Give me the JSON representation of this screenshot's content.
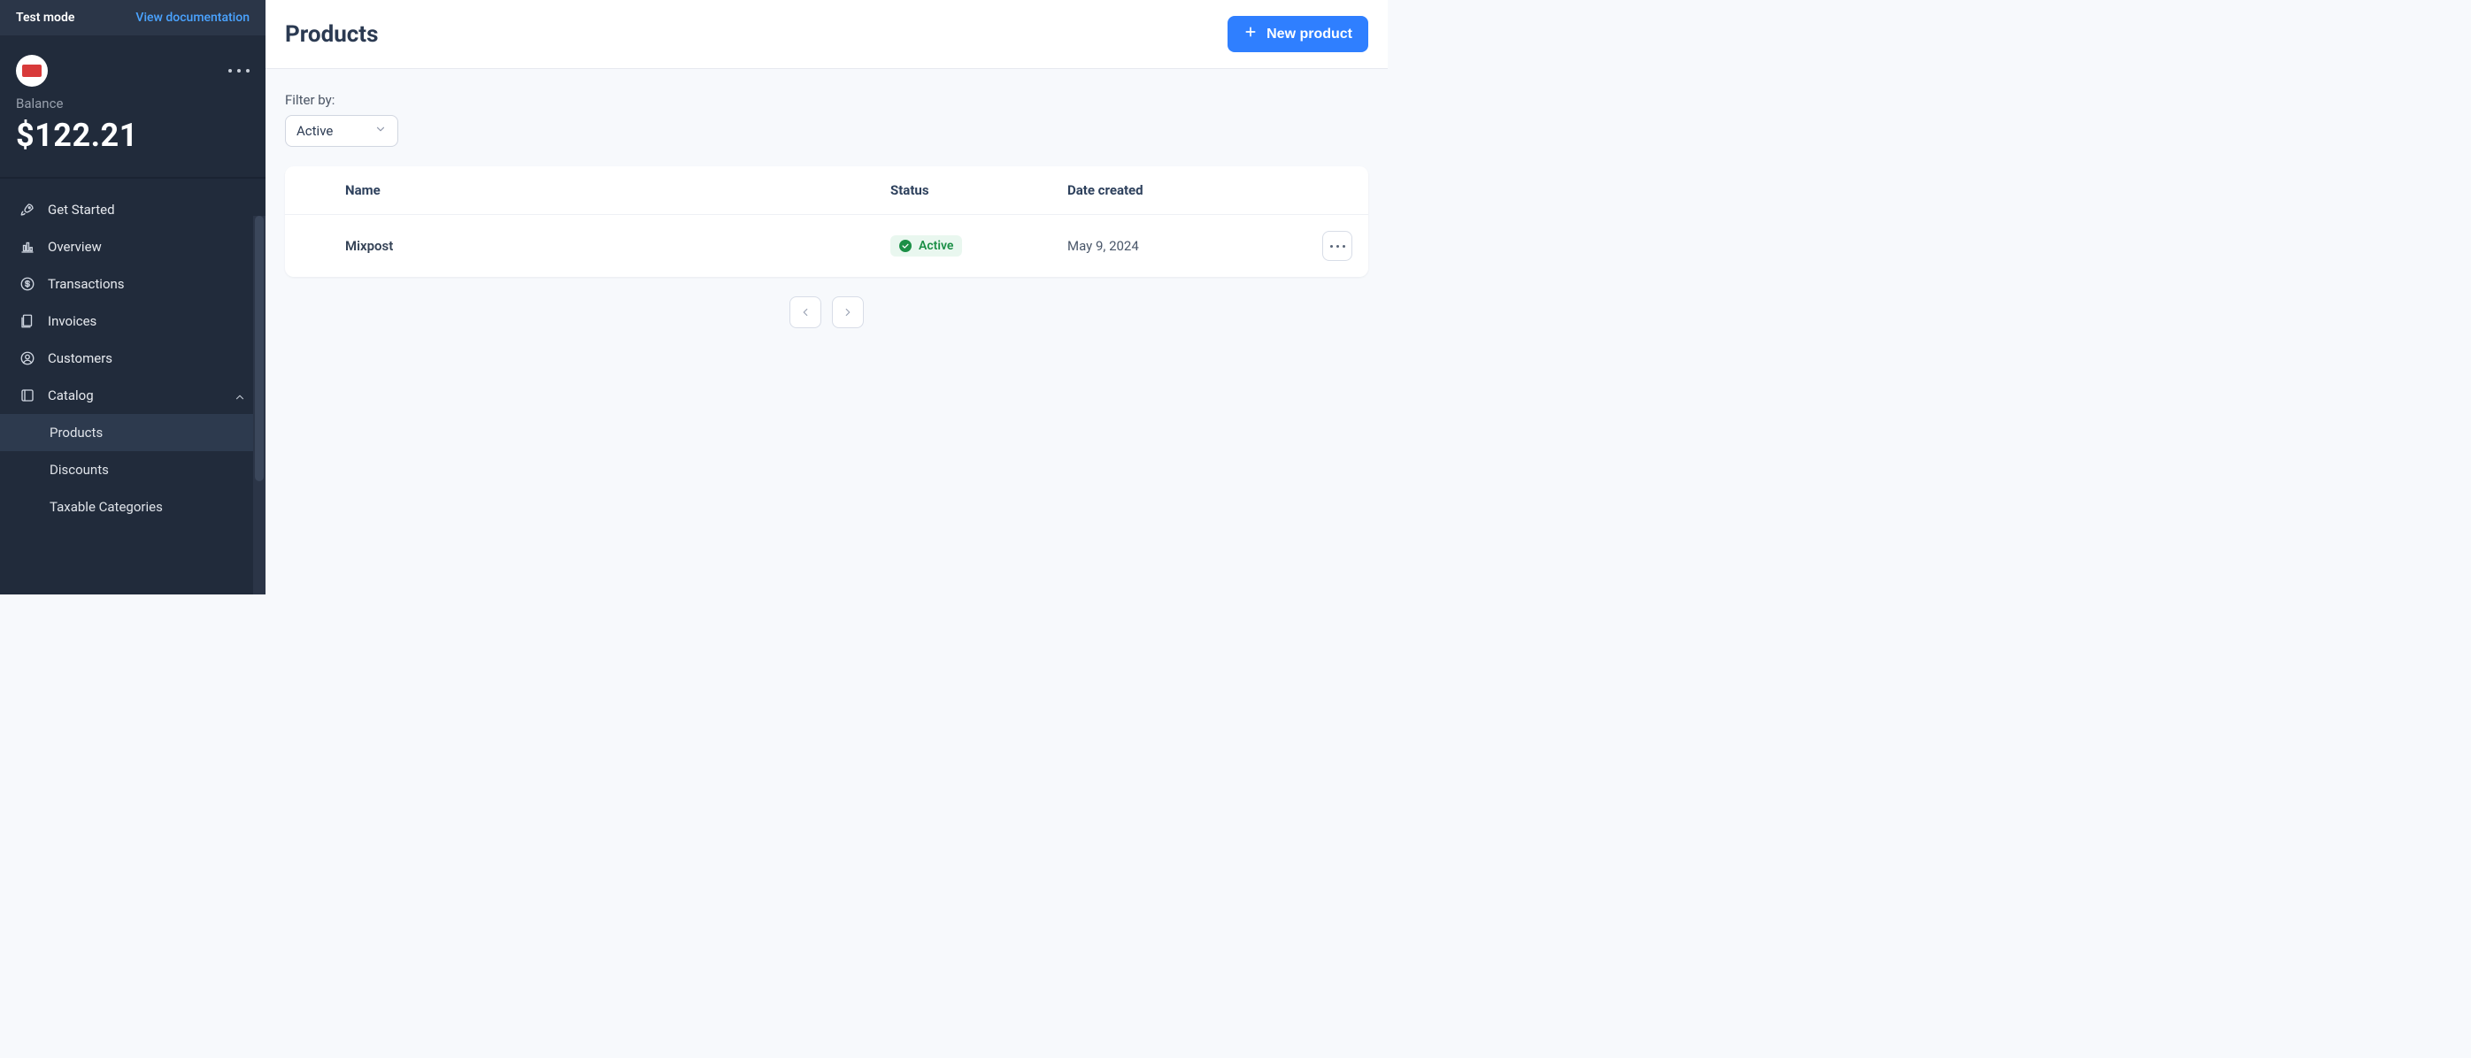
{
  "topbar": {
    "mode_label": "Test mode",
    "doc_link_label": "View documentation"
  },
  "account": {
    "balance_label": "Balance",
    "balance_amount": "$122.21"
  },
  "sidebar": {
    "items": [
      {
        "label": "Get Started"
      },
      {
        "label": "Overview"
      },
      {
        "label": "Transactions"
      },
      {
        "label": "Invoices"
      },
      {
        "label": "Customers"
      },
      {
        "label": "Catalog",
        "expanded": true,
        "children": [
          {
            "label": "Products",
            "active": true
          },
          {
            "label": "Discounts"
          },
          {
            "label": "Taxable Categories"
          }
        ]
      }
    ]
  },
  "header": {
    "title": "Products",
    "new_button_label": "New product"
  },
  "filter": {
    "label": "Filter by:",
    "selected": "Active"
  },
  "table": {
    "columns": {
      "name": "Name",
      "status": "Status",
      "date": "Date created"
    },
    "rows": [
      {
        "name": "Mixpost",
        "status": "Active",
        "date": "May 9, 2024"
      }
    ]
  }
}
